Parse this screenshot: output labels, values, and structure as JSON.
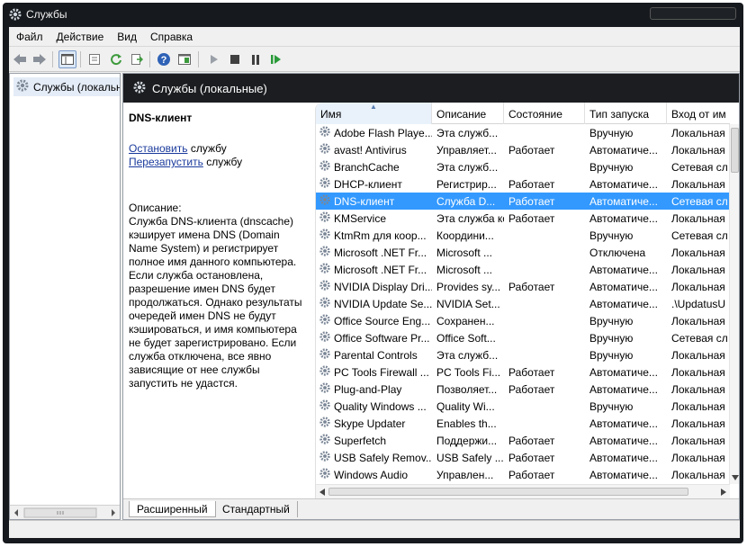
{
  "window": {
    "title": "Службы"
  },
  "menu": [
    "Файл",
    "Действие",
    "Вид",
    "Справка"
  ],
  "toolbar": {
    "icons": [
      "back-icon",
      "forward-icon",
      "show-tree-icon",
      "properties-icon",
      "refresh-icon",
      "export-icon",
      "help-icon",
      "console-icon",
      "start-icon",
      "stop-icon",
      "pause-icon",
      "restart-icon"
    ]
  },
  "tree": {
    "item_label": "Службы (локальны"
  },
  "panel": {
    "title": "Службы (локальные)"
  },
  "details": {
    "service_name": "DNS-клиент",
    "stop_link": "Остановить",
    "stop_suffix": " службу",
    "restart_link": "Перезапустить",
    "restart_suffix": " службу",
    "description_label": "Описание:",
    "description_text": "Служба DNS-клиента (dnscache) кэширует имена DNS (Domain Name System) и регистрирует полное имя данного компьютера. Если служба остановлена, разрешение имен DNS будет продолжаться. Однако результаты очередей имен DNS не будут кэшироваться, и имя компьютера не будет зарегистрировано. Если служба отключена, все явно зависящие от нее службы запустить не удастся."
  },
  "columns": {
    "name": "Имя",
    "desc": "Описание",
    "state": "Состояние",
    "startup": "Тип запуска",
    "logon": "Вход от им"
  },
  "services": [
    {
      "name": "Adobe Flash Playe...",
      "desc": "Эта служб...",
      "state": "",
      "startup": "Вручную",
      "logon": "Локальная"
    },
    {
      "name": "avast! Antivirus",
      "desc": "Управляет...",
      "state": "Работает",
      "startup": "Автоматиче...",
      "logon": "Локальная"
    },
    {
      "name": "BranchCache",
      "desc": "Эта служб...",
      "state": "",
      "startup": "Вручную",
      "logon": "Сетевая сл"
    },
    {
      "name": "DHCP-клиент",
      "desc": "Регистрир...",
      "state": "Работает",
      "startup": "Автоматиче...",
      "logon": "Локальная"
    },
    {
      "name": "DNS-клиент",
      "desc": "Служба D...",
      "state": "Работает",
      "startup": "Автоматиче...",
      "logon": "Сетевая сл",
      "selected": true
    },
    {
      "name": "KMService",
      "desc": "Эта служба ко...",
      "state": "Работает",
      "startup": "Автоматиче...",
      "logon": "Локальная"
    },
    {
      "name": "KtmRm для коор...",
      "desc": "Координи...",
      "state": "",
      "startup": "Вручную",
      "logon": "Сетевая сл"
    },
    {
      "name": "Microsoft .NET Fr...",
      "desc": "Microsoft ...",
      "state": "",
      "startup": "Отключена",
      "logon": "Локальная"
    },
    {
      "name": "Microsoft .NET Fr...",
      "desc": "Microsoft ...",
      "state": "",
      "startup": "Автоматиче...",
      "logon": "Локальная"
    },
    {
      "name": "NVIDIA Display Dri...",
      "desc": "Provides sy...",
      "state": "Работает",
      "startup": "Автоматиче...",
      "logon": "Локальная"
    },
    {
      "name": "NVIDIA Update Se...",
      "desc": "NVIDIA Set...",
      "state": "",
      "startup": "Автоматиче...",
      "logon": ".\\UpdatusU"
    },
    {
      "name": "Office Source Eng...",
      "desc": "Сохранен...",
      "state": "",
      "startup": "Вручную",
      "logon": "Локальная"
    },
    {
      "name": "Office Software Pr...",
      "desc": "Office Soft...",
      "state": "",
      "startup": "Вручную",
      "logon": "Сетевая сл"
    },
    {
      "name": "Parental Controls",
      "desc": "Эта служб...",
      "state": "",
      "startup": "Вручную",
      "logon": "Локальная"
    },
    {
      "name": "PC Tools Firewall ...",
      "desc": "PC Tools Fi...",
      "state": "Работает",
      "startup": "Автоматиче...",
      "logon": "Локальная"
    },
    {
      "name": "Plug-and-Play",
      "desc": "Позволяет...",
      "state": "Работает",
      "startup": "Автоматиче...",
      "logon": "Локальная"
    },
    {
      "name": "Quality Windows ...",
      "desc": "Quality Wi...",
      "state": "",
      "startup": "Вручную",
      "logon": "Локальная"
    },
    {
      "name": "Skype Updater",
      "desc": "Enables th...",
      "state": "",
      "startup": "Автоматиче...",
      "logon": "Локальная"
    },
    {
      "name": "Superfetch",
      "desc": "Поддержи...",
      "state": "Работает",
      "startup": "Автоматиче...",
      "logon": "Локальная"
    },
    {
      "name": "USB Safely Remov...",
      "desc": "USB Safely ...",
      "state": "Работает",
      "startup": "Автоматиче...",
      "logon": "Локальная"
    },
    {
      "name": "Windows Audio",
      "desc": "Управлен...",
      "state": "Работает",
      "startup": "Автоматиче...",
      "logon": "Локальная"
    }
  ],
  "tabs": [
    "Расширенный",
    "Стандартный"
  ],
  "colors": {
    "selection": "#3399ff",
    "header_dark": "#1b1d20",
    "link": "#1a3a9c"
  }
}
